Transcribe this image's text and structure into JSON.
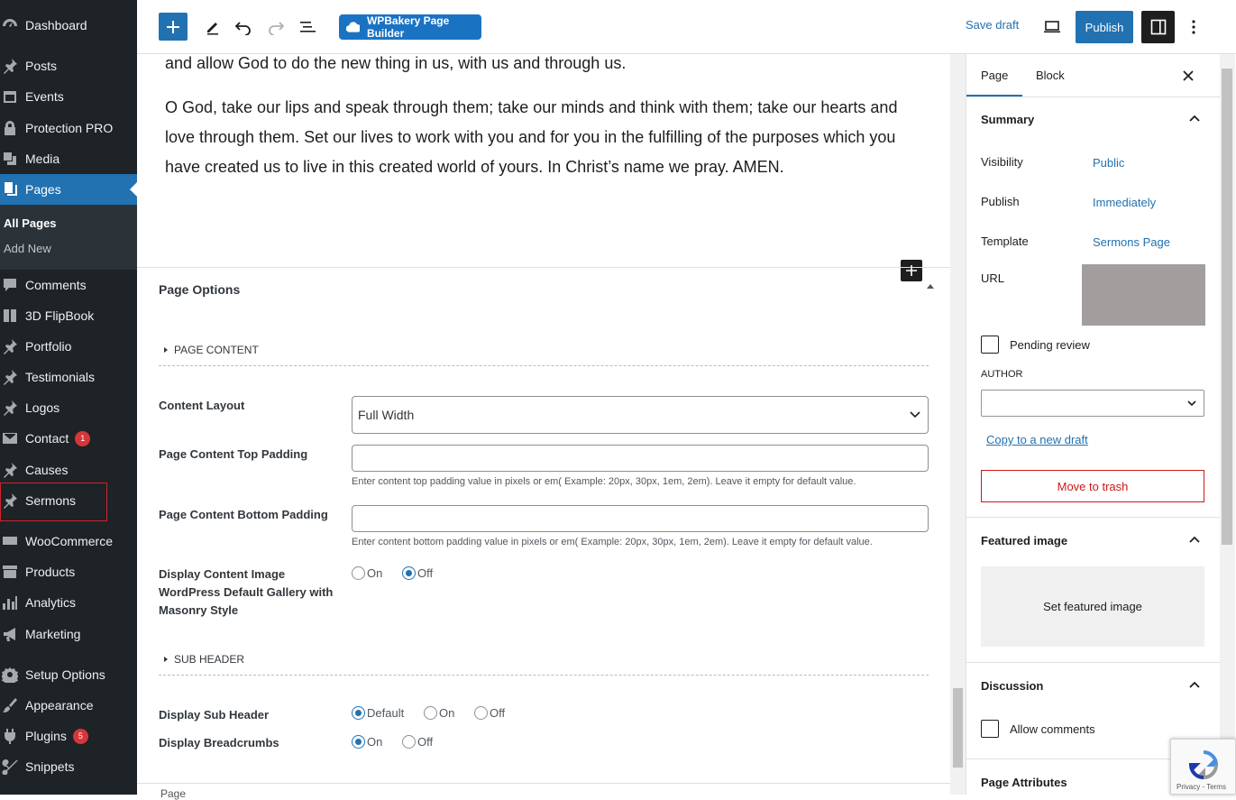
{
  "sidebar": {
    "items": [
      {
        "label": "Dashboard",
        "icon": "dashboard-icon"
      },
      {
        "label": "Posts",
        "icon": "pin-icon"
      },
      {
        "label": "Events",
        "icon": "events-icon"
      },
      {
        "label": "Protection PRO",
        "icon": "lock-icon"
      },
      {
        "label": "Media",
        "icon": "media-icon"
      },
      {
        "label": "Pages",
        "icon": "pages-icon"
      },
      {
        "label": "Comments",
        "icon": "comments-icon"
      },
      {
        "label": "3D FlipBook",
        "icon": "book-icon"
      },
      {
        "label": "Portfolio",
        "icon": "pin-icon"
      },
      {
        "label": "Testimonials",
        "icon": "pin-icon"
      },
      {
        "label": "Logos",
        "icon": "pin-icon"
      },
      {
        "label": "Contact",
        "icon": "mail-icon",
        "badge": "1"
      },
      {
        "label": "Causes",
        "icon": "pin-icon"
      },
      {
        "label": "Sermons",
        "icon": "pin-icon"
      },
      {
        "label": "WooCommerce",
        "icon": "woo-icon"
      },
      {
        "label": "Products",
        "icon": "archive-icon"
      },
      {
        "label": "Analytics",
        "icon": "bar-chart-icon"
      },
      {
        "label": "Marketing",
        "icon": "megaphone-icon"
      },
      {
        "label": "Setup Options",
        "icon": "gear-icon"
      },
      {
        "label": "Appearance",
        "icon": "brush-icon"
      },
      {
        "label": "Plugins",
        "icon": "plug-icon",
        "badge": "5"
      },
      {
        "label": "Snippets",
        "icon": "scissors-icon"
      }
    ],
    "submenu": [
      "All Pages",
      "Add New"
    ]
  },
  "toolbar": {
    "wpbakery_label": "WPBakery Page Builder",
    "save_draft": "Save draft",
    "publish": "Publish"
  },
  "content": {
    "para1": "and allow God to do the new thing in us, with us and through us.",
    "para2_line1": "O God, take our lips and speak through them; take our minds and think with them; take our hearts and",
    "para2_line2": "love through them. Set our lives to work with you and for you in the fulfilling of the purposes which you",
    "para2_line3": "have created us to live in this created world of yours. In Christ’s name we pray. AMEN."
  },
  "page_options": {
    "title": "Page Options",
    "section_page_content": "PAGE CONTENT",
    "content_layout_label": "Content Layout",
    "content_layout_value": "Full Width",
    "top_padding_label": "Page Content Top Padding",
    "top_padding_help": "Enter content top padding value in pixels or em( Example: 20px, 30px, 1em, 2em). Leave it empty for default value.",
    "bottom_padding_label": "Page Content Bottom Padding",
    "bottom_padding_help": "Enter content bottom padding value in pixels or em( Example: 20px, 30px, 1em, 2em). Leave it empty for default value.",
    "gallery_label": "Display Content Image WordPress Default Gallery with Masonry Style",
    "gallery_on": "On",
    "gallery_off": "Off",
    "section_sub_header": "SUB HEADER",
    "sub_header_label": "Display Sub Header",
    "sub_header_default": "Default",
    "sub_header_on": "On",
    "sub_header_off": "Off",
    "breadcrumbs_label": "Display Breadcrumbs",
    "breadcrumbs_on": "On",
    "breadcrumbs_off": "Off",
    "next_peek": "Page"
  },
  "panel": {
    "tab_page": "Page",
    "tab_block": "Block",
    "summary_title": "Summary",
    "visibility_label": "Visibility",
    "visibility_value": "Public",
    "publish_label": "Publish",
    "publish_value": "Immediately",
    "template_label": "Template",
    "template_value": "Sermons Page",
    "url_label": "URL",
    "pending_review": "Pending review",
    "author_label": "AUTHOR",
    "copy_draft": "Copy to a new draft",
    "move_trash": "Move to trash",
    "featured_title": "Featured image",
    "set_featured": "Set featured image",
    "discussion_title": "Discussion",
    "allow_comments": "Allow comments",
    "attributes_title": "Page Attributes"
  },
  "recaptcha": {
    "text": "Privacy - Terms"
  }
}
